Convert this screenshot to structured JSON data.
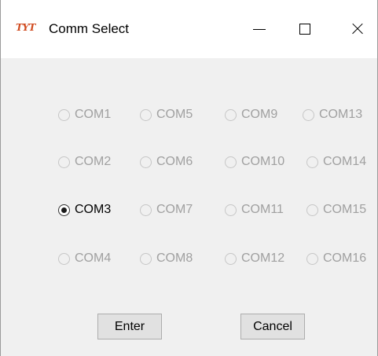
{
  "window": {
    "title": "Comm Select",
    "icon_text": "TYT"
  },
  "ports": {
    "selected": "COM3",
    "columns": [
      [
        "COM1",
        "COM2",
        "COM3",
        "COM4"
      ],
      [
        "COM5",
        "COM6",
        "COM7",
        "COM8"
      ],
      [
        "COM9",
        "COM10",
        "COM11",
        "COM12"
      ],
      [
        "COM13",
        "COM14",
        "COM15",
        "COM16"
      ]
    ]
  },
  "buttons": {
    "enter_label": "Enter",
    "cancel_label": "Cancel"
  },
  "icons": {
    "minimize": "minimize-icon",
    "maximize": "maximize-icon",
    "close": "close-icon",
    "app": "app-logo-icon"
  },
  "colors": {
    "dialog_bg": "#f0f0f0",
    "disabled_text": "#a0a0a0",
    "enabled_text": "#000000",
    "button_bg": "#e1e1e1",
    "logo": "#d04a1e"
  }
}
